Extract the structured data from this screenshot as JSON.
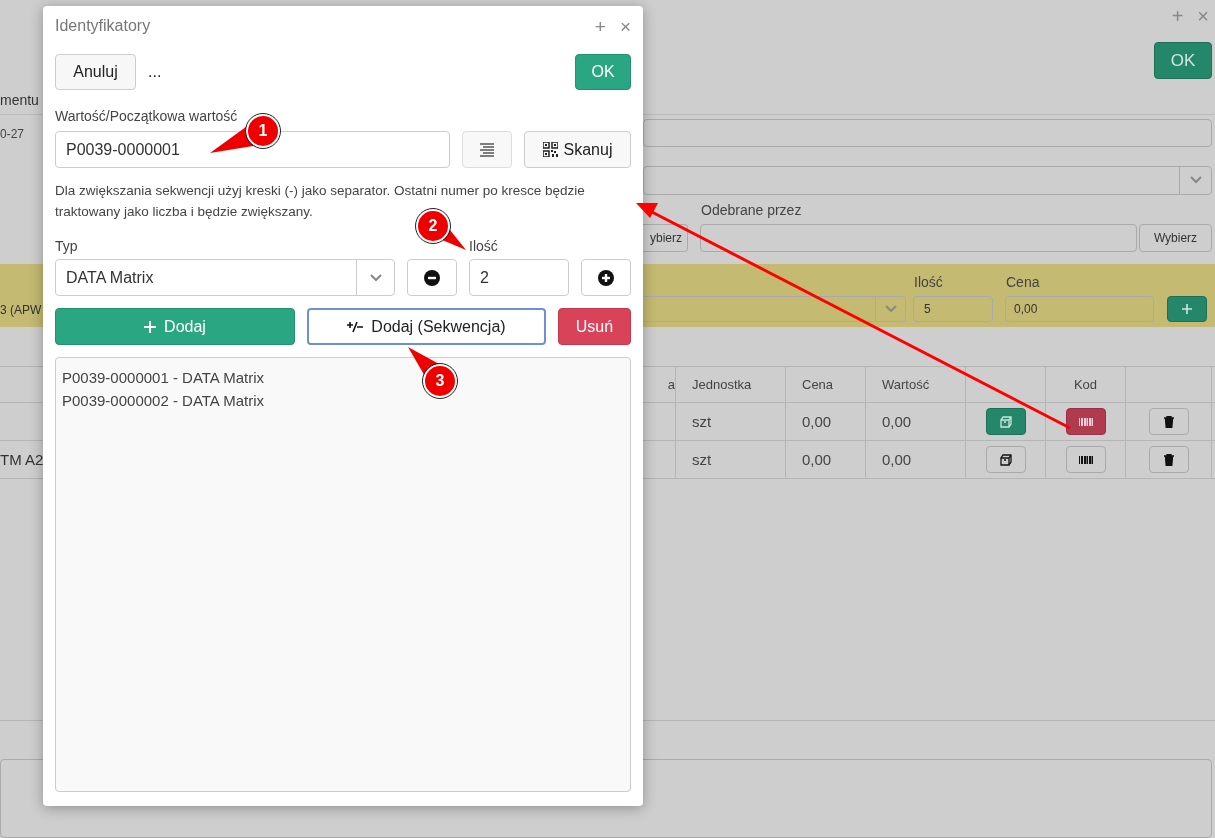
{
  "backdrop": {
    "window_controls": [
      "+",
      "×"
    ],
    "ok_button": "OK",
    "date_label": "mentu",
    "date_value": "0-27",
    "receiver_label": "Odebrane przez",
    "choose_buttons": [
      "ybierz",
      "Wybierz"
    ],
    "item_bar": {
      "product": "3 (APW",
      "quantity_label": "Ilość",
      "quantity": "5",
      "price_label": "Cena",
      "price": "0,00"
    },
    "table": {
      "columns": [
        "a",
        "Jednostka",
        "Cena",
        "Wartość"
      ],
      "code_column": "Kod",
      "rows": [
        {
          "unit": "szt",
          "price": "0,00",
          "value": "0,00",
          "stock_active": true,
          "code_active": true
        },
        {
          "product": "TM A2",
          "unit": "szt",
          "price": "0,00",
          "value": "0,00",
          "stock_active": false,
          "code_active": false
        }
      ]
    }
  },
  "dialog": {
    "title": "Identyfikatory",
    "header_controls": [
      "+",
      "×"
    ],
    "cancel_button": "Anuluj",
    "more_button": "...",
    "ok_button": "OK",
    "value_label": "Wartość/Początkowa wartość",
    "value": "P0039-0000001",
    "scan_button": "Skanuj",
    "hint": "Dla zwiększania sekwencji użyj kreski (-) jako separator. Ostatni numer po kresce będzie traktowany jako liczba i będzie zwiększany.",
    "type_label": "Typ",
    "type": "DATA Matrix",
    "quantity_label": "Ilość",
    "quantity": "2",
    "add_button": "Dodaj",
    "add_sequence_button": {
      "label": "Dodaj (Sekwencja)",
      "focused": true
    },
    "remove_button": "Usuń",
    "identifiers": [
      "P0039-0000001 - DATA Matrix",
      "P0039-0000002 - DATA Matrix"
    ]
  },
  "annotations": [
    "1",
    "2",
    "3"
  ]
}
